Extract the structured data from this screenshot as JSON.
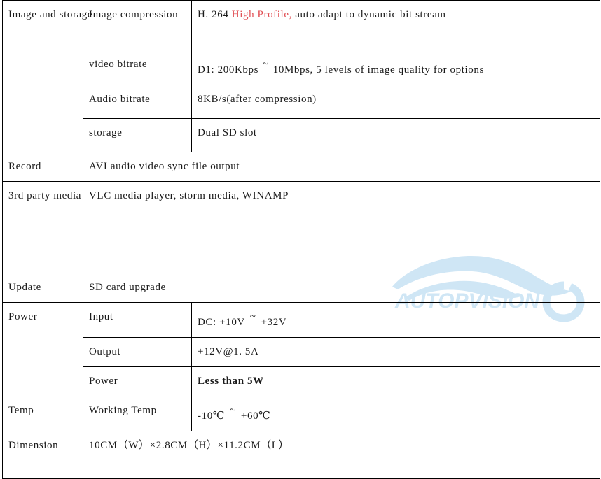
{
  "document": {
    "type": "product-specification-table",
    "watermark": {
      "text": "AUTOPVISION",
      "color": "#cfe6f5",
      "shape": "car-silhouette"
    },
    "colors": {
      "text": "#1a1a1a",
      "accent_red": "#e04a4f",
      "strong_red": "#cf1414",
      "border": "#000000",
      "watermark_blue": "#cfe6f5"
    }
  },
  "table": {
    "rows": [
      {
        "category": "Image and storage",
        "sub": "Image compression",
        "value_segments": [
          {
            "text": "H. 264 ",
            "style": "normal"
          },
          {
            "text": "High Profile,",
            "style": "red"
          },
          {
            "text": " auto adapt to dynamic bit stream",
            "style": "normal"
          }
        ],
        "value_plain": "H. 264 High Profile, auto adapt to dynamic bit stream"
      },
      {
        "sub": "video bitrate",
        "value_plain": "D1: 200Kbps ~ 10Mbps, 5 levels of image quality for options"
      },
      {
        "sub": "Audio bitrate",
        "value_plain": "8KB/s(after compression)"
      },
      {
        "sub": "storage",
        "value_plain": "Dual SD slot"
      },
      {
        "category": "Record",
        "value_plain": "AVI audio video sync file output",
        "value_style": "red"
      },
      {
        "category": "3rd party media",
        "value_plain": "VLC media player, storm media, WINAMP"
      },
      {
        "category": "Update",
        "value_plain": "SD card upgrade"
      },
      {
        "category": "Power",
        "sub": "Input",
        "value_plain": "DC: +10V ~ +32V"
      },
      {
        "sub": "Output",
        "value_plain": "+12V@1. 5A"
      },
      {
        "sub": "Power",
        "value_plain": "Less than 5W",
        "value_style": "red-strong"
      },
      {
        "category": "Temp",
        "sub": "Working Temp",
        "value_plain": "-10℃ ~ +60℃"
      },
      {
        "category": "Dimension",
        "value_plain": "10CM（W）×2.8CM（H）×11.2CM（L）",
        "value_style": "red"
      }
    ]
  },
  "cells": {
    "r1_cat": "Image and storage",
    "r1_sub": "Image compression",
    "r1_v_a": "H. 264 ",
    "r1_v_b": "High Profile,",
    "r1_v_c": " auto adapt to dynamic bit stream",
    "r2_sub": "video bitrate",
    "r2_val_a": "D1: 200Kbps",
    "r2_val_tilde": "~",
    "r2_val_b": "10Mbps, 5 levels of image quality for options",
    "r3_sub": "Audio bitrate",
    "r3_val": "8KB/s(after compression)",
    "r4_sub": "storage",
    "r4_val": "Dual SD slot",
    "r5_cat": "Record",
    "r5_val": "AVI audio video sync file output",
    "r6_cat": "3rd party media",
    "r6_val": "VLC media player, storm media, WINAMP",
    "r7_cat": "Update",
    "r7_val": "SD card upgrade",
    "r8_cat": "Power",
    "r8_sub": "Input",
    "r8_val_a": "DC: +10V",
    "r8_val_tilde": "~",
    "r8_val_b": "+32V",
    "r9_sub": "Output",
    "r9_val": "+12V@1. 5A",
    "r10_sub": "Power",
    "r10_val": "Less than 5W",
    "r11_cat": "Temp",
    "r11_sub": "Working Temp",
    "r11_val_a": "-10℃",
    "r11_val_tilde": "~",
    "r11_val_b": "+60℃",
    "r12_cat": "Dimension",
    "r12_val": "10CM（W）×2.8CM（H）×11.2CM（L）"
  }
}
